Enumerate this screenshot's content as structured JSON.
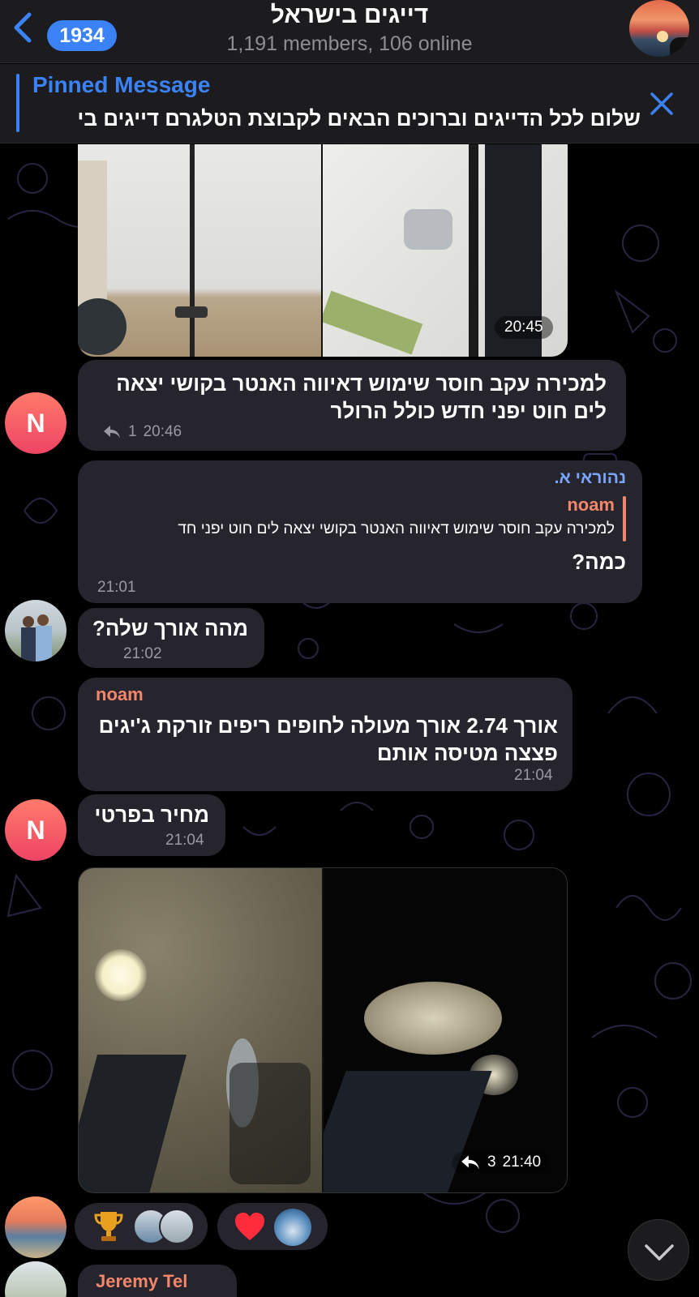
{
  "header": {
    "back_count": "1934",
    "title": "דייגים בישראל",
    "subtitle": "1,191 members, 106 online"
  },
  "pinned": {
    "title": "Pinned Message",
    "text": "שלום לכל הדייגים וברוכים הבאים לקבוצת הטלגרם דייגים בי"
  },
  "messages": {
    "photos_top": {
      "time": "20:45"
    },
    "sale": {
      "text": "למכירה עקב חוסר שימוש דאיווה האנטר בקושי יצאה לים חוט יפני חדש כולל הרולר",
      "replies": "1",
      "time": "20:46",
      "avatar_letter": "N"
    },
    "reply_msg": {
      "sender": "נהוראי א.",
      "quote_sender": "noam",
      "quote_text": "למכירה עקב חוסר שימוש דאיווה האנטר בקושי יצאה לים חוט יפני חד",
      "text": "כמה?",
      "time": "21:01"
    },
    "length_q": {
      "text": "מהה אורך שלה?",
      "time": "21:02"
    },
    "noam_answer": {
      "sender": "noam",
      "text": "אורך 2.74 אורך מעולה לחופים ריפים זורקת ג'יגים פצצה מטיסה אותם",
      "time": "21:04"
    },
    "private_price": {
      "text": "מחיר בפרטי",
      "time": "21:04",
      "avatar_letter": "N"
    },
    "photos_fish": {
      "replies": "3",
      "time": "21:40"
    },
    "next_sender": "Jeremy Tel"
  },
  "colors": {
    "accent": "#3a82f6",
    "bubble": "#26252d",
    "sender_noam": "#f2876b",
    "sender_nehorai": "#7aa6ff",
    "header_bg": "#1c1c1e"
  },
  "icons": [
    "back-chevron-icon",
    "close-icon",
    "reply-arrow-icon",
    "trophy-icon",
    "heart-icon",
    "chevron-down-icon"
  ]
}
